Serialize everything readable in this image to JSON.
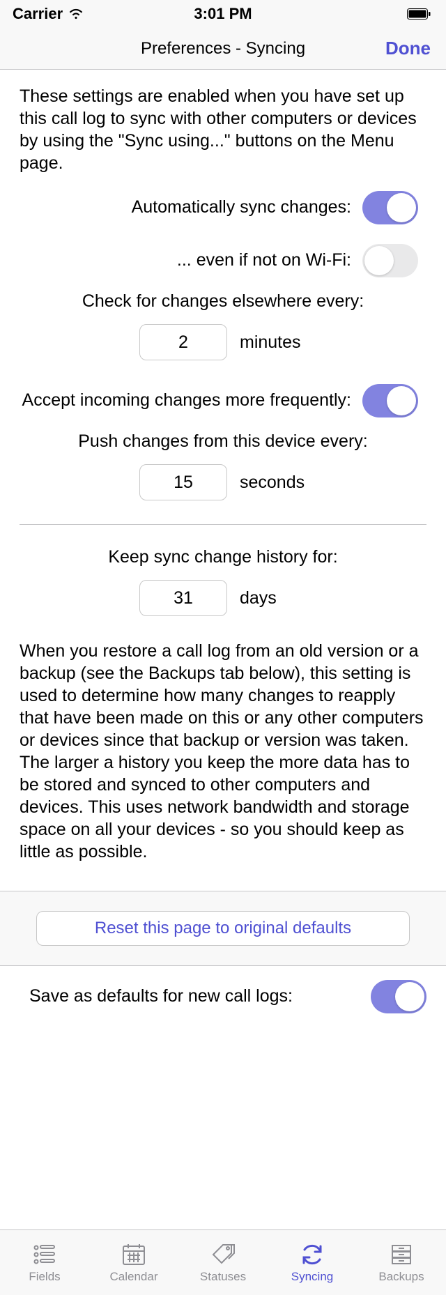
{
  "statusbar": {
    "carrier": "Carrier",
    "time": "3:01 PM"
  },
  "navbar": {
    "title": "Preferences - Syncing",
    "done": "Done"
  },
  "intro": "These settings are enabled when you have set up this call log to sync with other computers or devices by using the \"Sync using...\" buttons on the Menu page.",
  "rows": {
    "auto_sync": {
      "label": "Automatically sync changes:",
      "on": true
    },
    "no_wifi": {
      "label": "... even if not on Wi-Fi:",
      "on": false
    },
    "check_every_label": "Check for changes elsewhere every:",
    "check_every_value": "2",
    "check_every_unit": "minutes",
    "accept_freq": {
      "label": "Accept incoming changes more frequently:",
      "on": true
    },
    "push_every_label": "Push changes from this device every:",
    "push_every_value": "15",
    "push_every_unit": "seconds",
    "history_label": "Keep sync change history for:",
    "history_value": "31",
    "history_unit": "days"
  },
  "explain": "When you restore a call log from an old version or a backup (see the Backups tab below), this setting is used to determine how many changes to reapply that have been made on this or any other computers or devices since that backup or version was taken. The larger a history you keep the more data has to be stored and synced to other computers and devices. This uses network bandwidth and storage space on all your devices - so you should keep as little as possible.",
  "reset": "Reset this page to original defaults",
  "save_defaults": {
    "label": "Save as defaults for new call logs:",
    "on": true
  },
  "tabs": {
    "fields": "Fields",
    "calendar": "Calendar",
    "statuses": "Statuses",
    "syncing": "Syncing",
    "backups": "Backups"
  }
}
